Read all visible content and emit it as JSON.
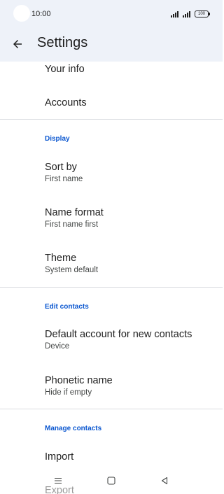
{
  "status_bar": {
    "time": "10:00",
    "battery": "100"
  },
  "app_bar": {
    "title": "Settings",
    "back_icon": "arrow-left-icon"
  },
  "items": {
    "your_info": {
      "title": "Your info"
    },
    "accounts": {
      "title": "Accounts"
    },
    "sort_by": {
      "title": "Sort by",
      "subtitle": "First name"
    },
    "name_format": {
      "title": "Name format",
      "subtitle": "First name first"
    },
    "theme": {
      "title": "Theme",
      "subtitle": "System default"
    },
    "default_account": {
      "title": "Default account for new contacts",
      "subtitle": "Device"
    },
    "phonetic_name": {
      "title": "Phonetic name",
      "subtitle": "Hide if empty"
    },
    "import": {
      "title": "Import"
    },
    "export": {
      "title": "Export"
    }
  },
  "sections": {
    "display": "Display",
    "edit_contacts": "Edit contacts",
    "manage_contacts": "Manage contacts"
  },
  "nav_bar": {
    "icons": [
      "menu-icon",
      "home-square-icon",
      "back-triangle-icon"
    ]
  },
  "colors": {
    "accent": "#0b57d0",
    "header_bg": "#eef2f9",
    "divider": "#dadce0"
  }
}
